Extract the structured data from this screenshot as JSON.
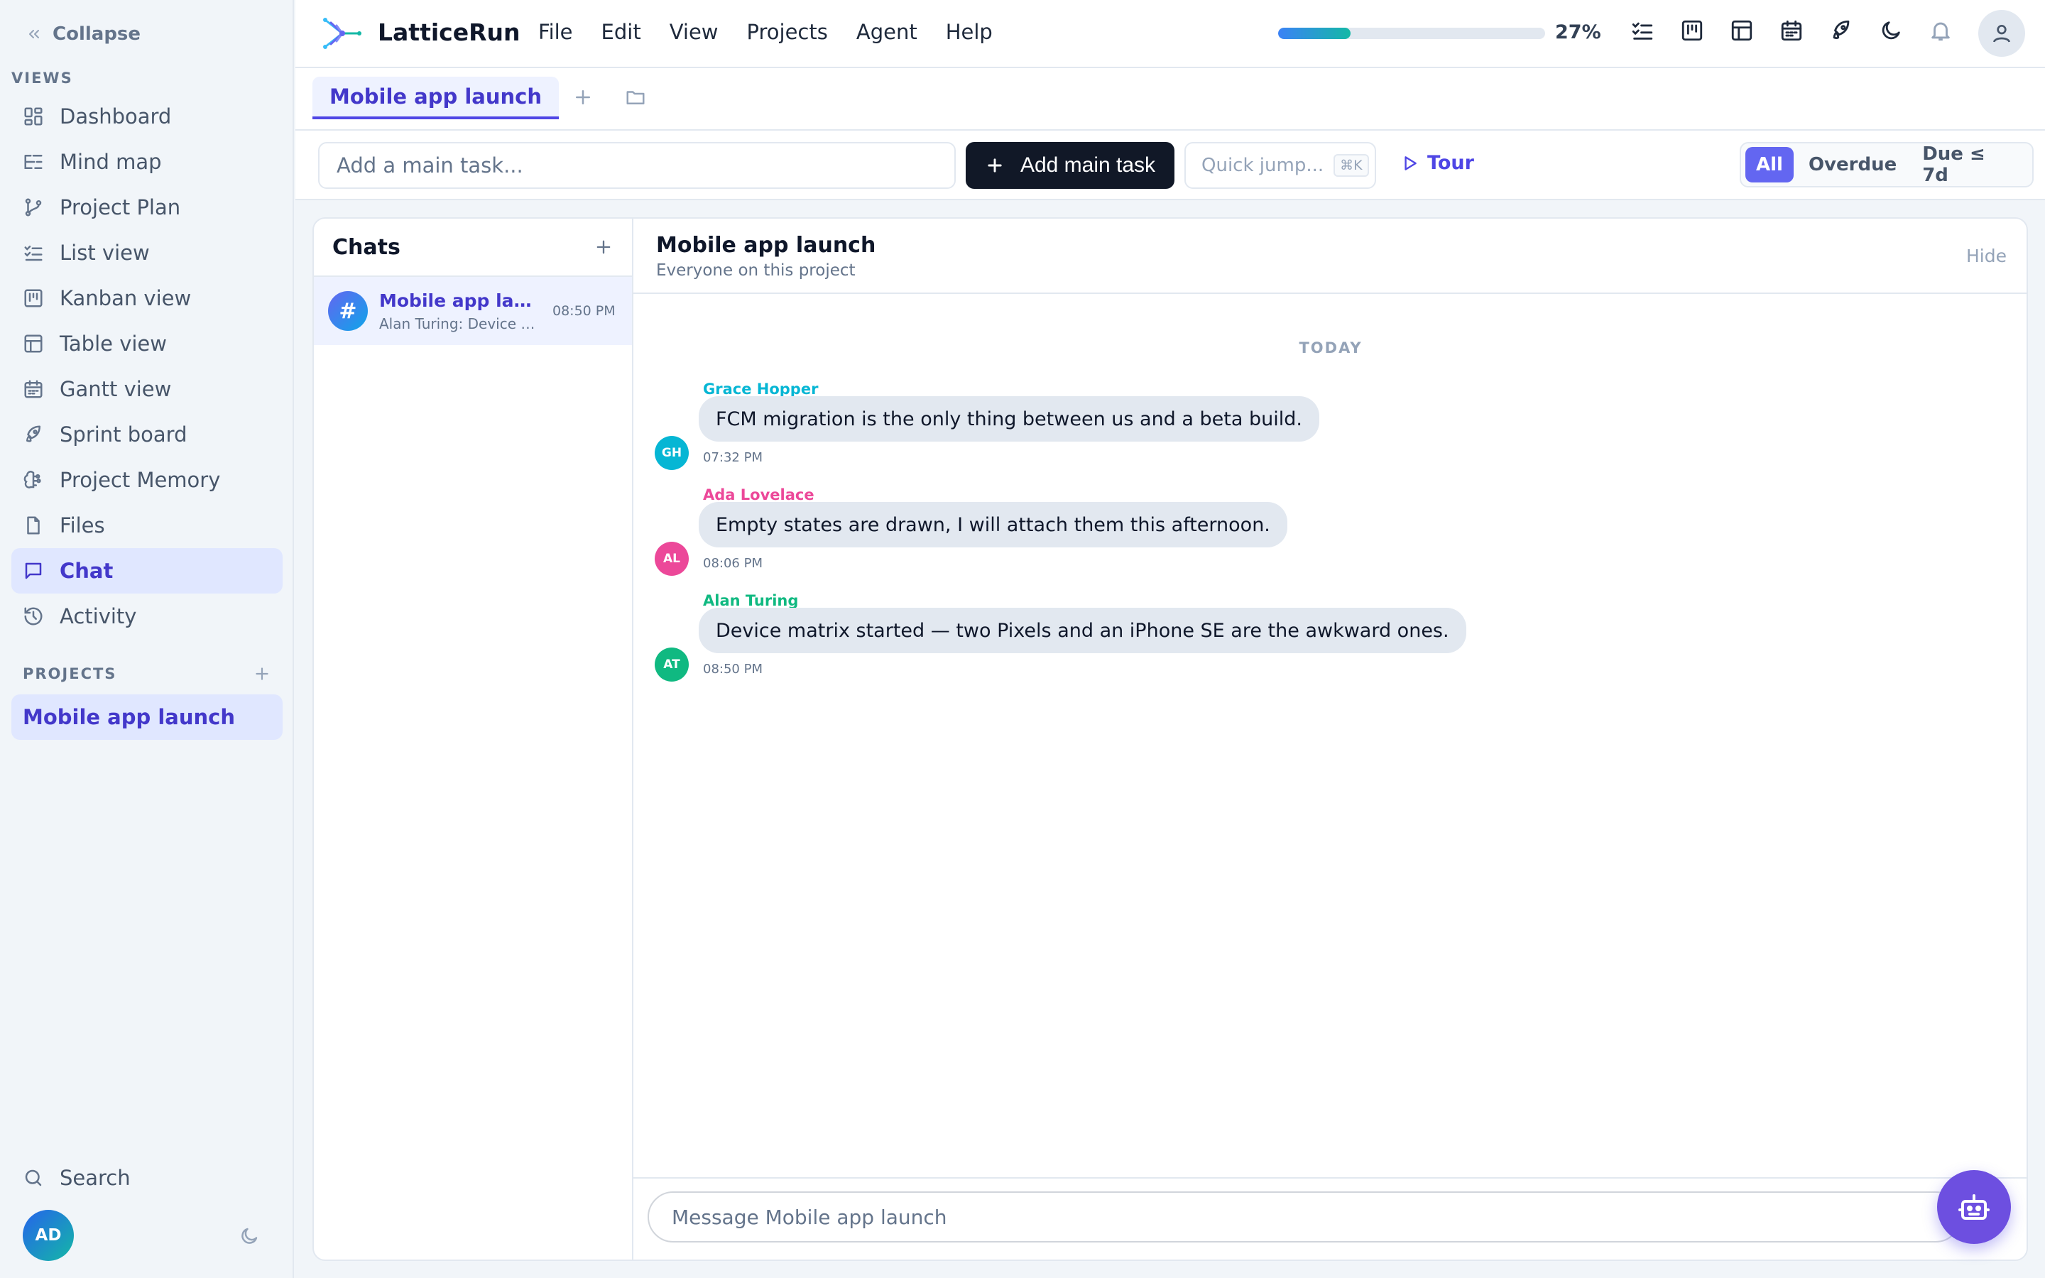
{
  "sidebar": {
    "collapse_label": "Collapse",
    "views_label": "VIEWS",
    "items": [
      {
        "label": "Dashboard",
        "icon": "dashboard-icon"
      },
      {
        "label": "Mind map",
        "icon": "mind-map-icon"
      },
      {
        "label": "Project Plan",
        "icon": "branch-icon"
      },
      {
        "label": "List view",
        "icon": "list-check-icon"
      },
      {
        "label": "Kanban view",
        "icon": "kanban-icon"
      },
      {
        "label": "Table view",
        "icon": "table-icon"
      },
      {
        "label": "Gantt view",
        "icon": "calendar-icon"
      },
      {
        "label": "Sprint board",
        "icon": "rocket-icon"
      },
      {
        "label": "Project Memory",
        "icon": "brain-icon"
      },
      {
        "label": "Files",
        "icon": "file-icon"
      },
      {
        "label": "Chat",
        "icon": "chat-icon",
        "active": true
      },
      {
        "label": "Activity",
        "icon": "history-icon"
      }
    ],
    "projects_label": "PROJECTS",
    "projects": [
      {
        "label": "Mobile app launch",
        "active": true
      }
    ],
    "search_label": "Search",
    "user_initials": "AD"
  },
  "topbar": {
    "app_name": "LatticeRun",
    "menu": [
      "File",
      "Edit",
      "View",
      "Projects",
      "Agent",
      "Help"
    ],
    "progress_percent": 27,
    "progress_label": "27%",
    "icons": [
      "list-check-icon",
      "kanban-icon",
      "table-icon",
      "calendar-icon",
      "rocket-icon",
      "moon-icon",
      "bell-icon",
      "user-icon"
    ]
  },
  "tabs": {
    "items": [
      {
        "label": "Mobile app launch",
        "active": true
      }
    ]
  },
  "toolbar": {
    "main_task_placeholder": "Add a main task...",
    "add_main_task_label": "Add main task",
    "quick_jump_placeholder": "Quick jump...",
    "quick_jump_shortcut": "⌘K",
    "tour_label": "Tour",
    "filters": [
      {
        "label": "All",
        "active": true
      },
      {
        "label": "Overdue"
      },
      {
        "label": "Due ≤ 7d"
      }
    ]
  },
  "chats": {
    "title": "Chats",
    "list": [
      {
        "name": "Mobile app launch",
        "preview": "Alan Turing: Device matrix started — two Pixels and an iPhone SE are the awkward ones.",
        "time": "08:50 PM",
        "avatar_glyph": "#"
      }
    ]
  },
  "conversation": {
    "title": "Mobile app launch",
    "subtitle": "Everyone on this project",
    "hide_label": "Hide",
    "day_label": "TODAY",
    "messages": [
      {
        "author": "Grace Hopper",
        "initials": "GH",
        "color": "#06b6d4",
        "text": "FCM migration is the only thing between us and a beta build.",
        "time": "07:32 PM"
      },
      {
        "author": "Ada Lovelace",
        "initials": "AL",
        "color": "#ec4899",
        "text": "Empty states are drawn, I will attach them this afternoon.",
        "time": "08:06 PM"
      },
      {
        "author": "Alan Turing",
        "initials": "AT",
        "color": "#10b981",
        "text": "Device matrix started — two Pixels and an iPhone SE are the awkward ones.",
        "time": "08:50 PM"
      }
    ],
    "composer_placeholder": "Message Mobile app launch"
  },
  "colors": {
    "accent": "#4f46e5",
    "active_bg": "#e0e7ff",
    "fab": "#6d4fe0"
  }
}
